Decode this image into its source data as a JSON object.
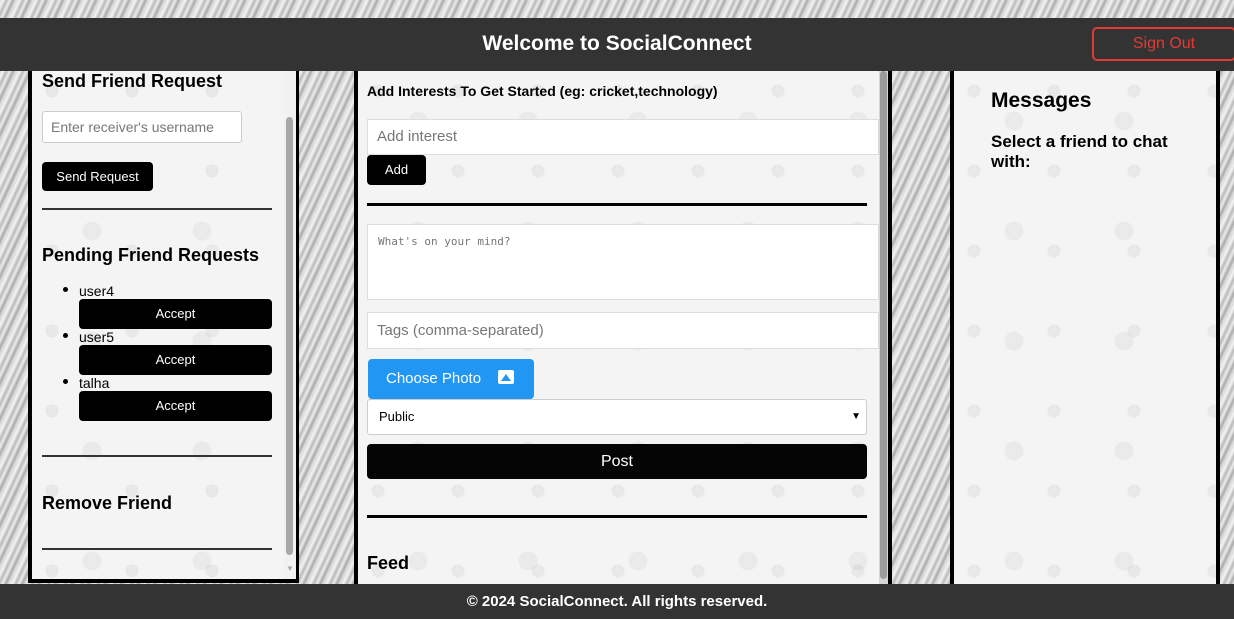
{
  "header": {
    "title": "Welcome to SocialConnect",
    "sign_out_label": "Sign Out"
  },
  "left_panel": {
    "send_request_title": "Send Friend Request",
    "username_placeholder": "Enter receiver's username",
    "send_button_label": "Send Request",
    "pending_title": "Pending Friend Requests",
    "pending_requests": [
      {
        "username": "user4",
        "accept_label": "Accept"
      },
      {
        "username": "user5",
        "accept_label": "Accept"
      },
      {
        "username": "talha",
        "accept_label": "Accept"
      }
    ],
    "remove_friend_title": "Remove Friend"
  },
  "center_panel": {
    "interests_label": "Add Interests To Get Started (eg: cricket,technology)",
    "interest_placeholder": "Add interest",
    "add_button_label": "Add",
    "post_placeholder": "What's on your mind?",
    "tags_placeholder": "Tags (comma-separated)",
    "choose_photo_label": "Choose Photo",
    "visibility_selected": "Public",
    "post_button_label": "Post",
    "feed_title": "Feed"
  },
  "right_panel": {
    "messages_title": "Messages",
    "chat_prompt": "Select a friend to chat with:"
  },
  "footer": {
    "text": "© 2024 SocialConnect. All rights reserved."
  },
  "colors": {
    "header_bg": "#333333",
    "sign_out": "#e53935",
    "choose_photo": "#2196f3",
    "button": "#000000"
  }
}
